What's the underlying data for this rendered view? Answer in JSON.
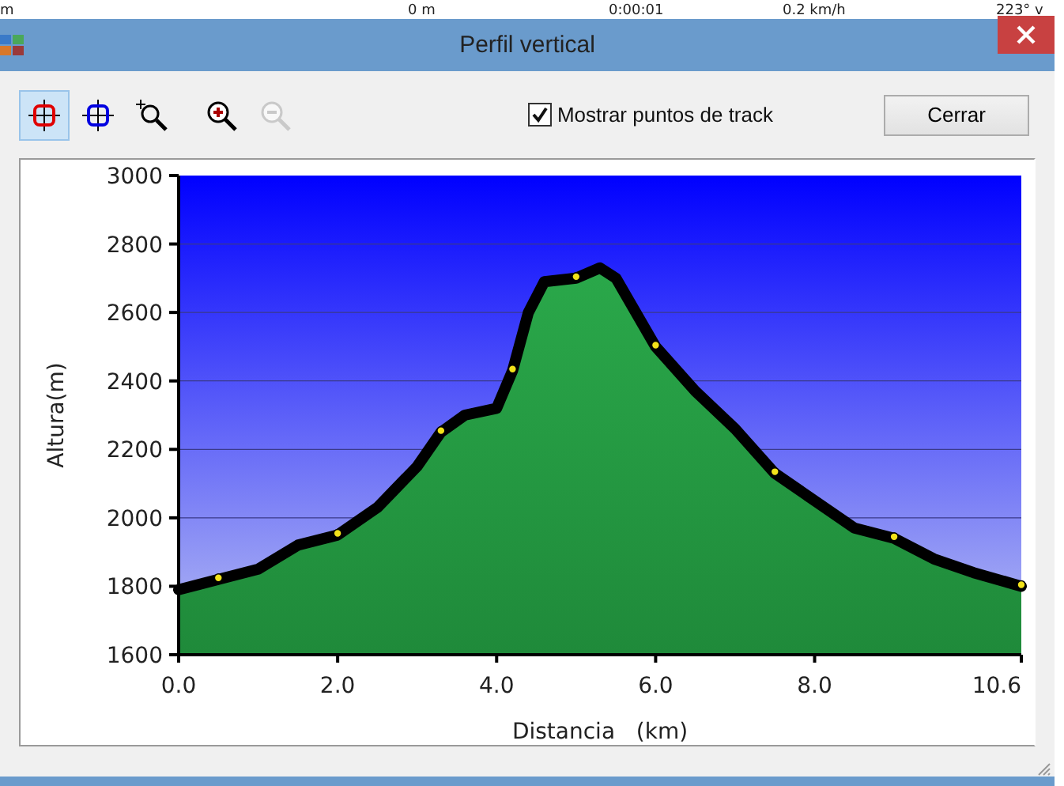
{
  "background_row": [
    "m",
    "0 m",
    "0:00:01",
    "0.2 km/h",
    "223° v"
  ],
  "window": {
    "title": "Perfil vertical"
  },
  "toolbar": [
    {
      "kind": "cursor-red",
      "selected": true,
      "disabled": false
    },
    {
      "kind": "cursor-blue",
      "selected": false,
      "disabled": false
    },
    {
      "kind": "zoom-area",
      "selected": false,
      "disabled": false
    },
    {
      "kind": "zoom-in",
      "selected": false,
      "disabled": false
    },
    {
      "kind": "zoom-out",
      "selected": false,
      "disabled": true
    }
  ],
  "show_points": {
    "label": "Mostrar puntos de track",
    "checked": true
  },
  "close_button": "Cerrar",
  "chart": {
    "chart_data": {
      "type": "area",
      "xlabel": "Distancia   (km)",
      "ylabel": "Altura(m)",
      "xlim": [
        0,
        10.6
      ],
      "ylim": [
        1600,
        3000
      ],
      "x": [
        0,
        0.5,
        1,
        1.5,
        2,
        2.5,
        3,
        3.3,
        3.6,
        4,
        4.2,
        4.4,
        4.6,
        5,
        5.3,
        5.5,
        6,
        6.5,
        7,
        7.5,
        8,
        8.5,
        9,
        9.5,
        10,
        10.6
      ],
      "series": [
        {
          "color": "#000000",
          "values": [
            1790,
            1820,
            1850,
            1920,
            1950,
            2030,
            2150,
            2250,
            2300,
            2320,
            2430,
            2600,
            2690,
            2700,
            2730,
            2700,
            2500,
            2370,
            2260,
            2130,
            2050,
            1970,
            1940,
            1880,
            1840,
            1800
          ]
        }
      ],
      "xticks": [
        {
          "value": 0,
          "label": "0.0"
        },
        {
          "value": 2,
          "label": "2.0"
        },
        {
          "value": 4,
          "label": "4.0"
        },
        {
          "value": 6,
          "label": "6.0"
        },
        {
          "value": 8,
          "label": "8.0"
        },
        {
          "value": 10.6,
          "label": "10.6"
        }
      ],
      "yticks": [
        1600,
        1800,
        2000,
        2200,
        2400,
        2600,
        2800,
        3000
      ],
      "grid": true
    }
  }
}
